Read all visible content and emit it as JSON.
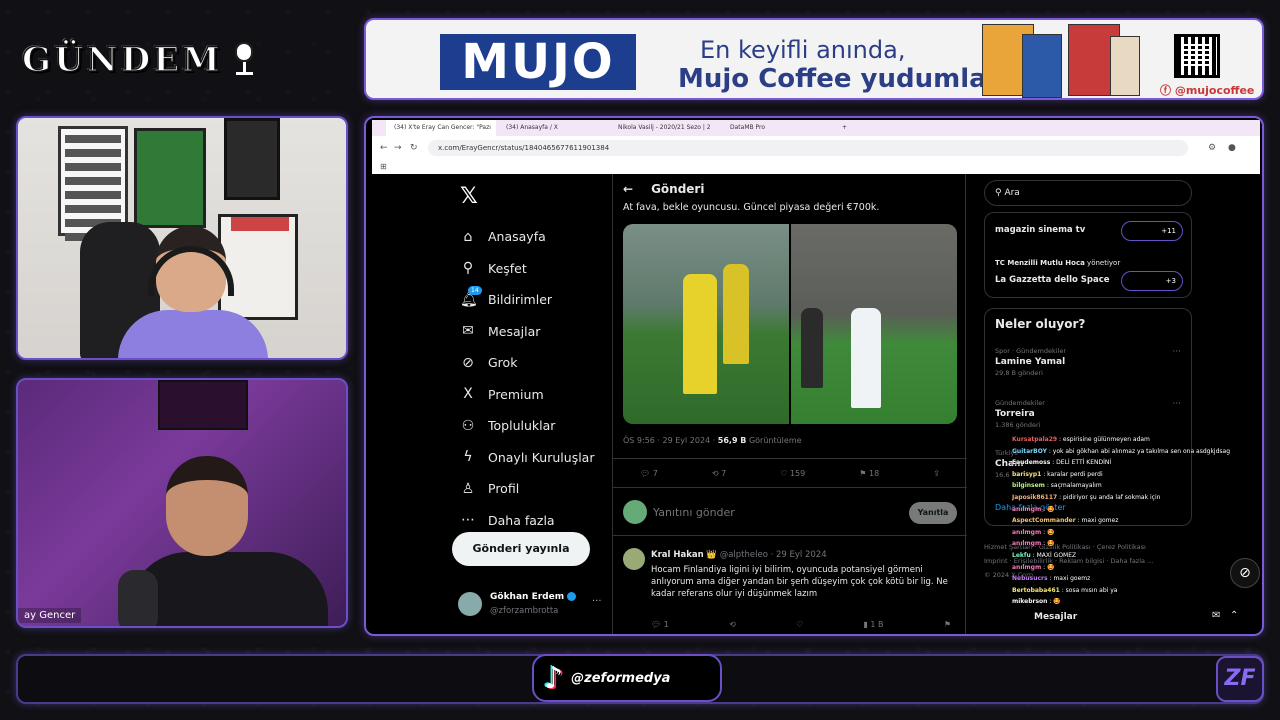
{
  "overlay": {
    "logo_text": "GÜNDEM",
    "camera_name": "ay Gencer",
    "tiktok_handle": "@zeformedya",
    "brand_mark": "ZF"
  },
  "ad": {
    "brand": "MUJO",
    "line1": "En keyifli anında,",
    "line2": "Mujo Coffee yudumla!",
    "handle": "@mujocoffee",
    "accent": "#2b3e86"
  },
  "browser": {
    "tabs": [
      {
        "label": "(34) X'te Eray Can Gencer: \"Pazı",
        "active": true
      },
      {
        "label": "(34) Anasayfa / X",
        "active": false
      },
      {
        "label": "Nikola Vasilj - 2020/21 Sezo | 2",
        "active": false
      },
      {
        "label": "DataMB Pro",
        "active": false
      }
    ],
    "url": "x.com/ErayGencr/status/1840465677611901384"
  },
  "x": {
    "nav": [
      {
        "icon": "home-icon",
        "glyph": "⌂",
        "label": "Anasayfa"
      },
      {
        "icon": "search-icon",
        "glyph": "⚲",
        "label": "Keşfet"
      },
      {
        "icon": "bell-icon",
        "glyph": "♫",
        "label": "Bildirimler",
        "badge": "14"
      },
      {
        "icon": "mail-icon",
        "glyph": "✉",
        "label": "Mesajlar"
      },
      {
        "icon": "grok-icon",
        "glyph": "⊘",
        "label": "Grok"
      },
      {
        "icon": "x-premium-icon",
        "glyph": "X",
        "label": "Premium"
      },
      {
        "icon": "communities-icon",
        "glyph": "⚇",
        "label": "Topluluklar"
      },
      {
        "icon": "bolt-icon",
        "glyph": "ϟ",
        "label": "Onaylı Kuruluşlar"
      },
      {
        "icon": "profile-icon",
        "glyph": "♙",
        "label": "Profil"
      },
      {
        "icon": "more-icon",
        "glyph": "⋯",
        "label": "Daha fazla"
      }
    ],
    "post_button": "Gönderi yayınla",
    "account": {
      "name": "Gökhan Erdem",
      "handle": "@zforzambrotta"
    },
    "header_title": "Gönderi",
    "post_text": "At fava, bekle oyuncusu. Güncel piyasa değeri €700k.",
    "post_meta_time": "ÖS 9:56 · 29 Eyl 2024 · ",
    "post_meta_views": "56,9 B",
    "post_meta_views_label": " Görüntüleme",
    "actions": {
      "replies": "7",
      "reposts": "7",
      "likes": "159",
      "bookmarks": "18"
    },
    "reply_placeholder": "Yanıtını gönder",
    "reply_button": "Yanıtla",
    "comment": {
      "name": "Kral Hakan",
      "handle": "@alptheleo · 29 Eyl 2024",
      "text": "Hocam Finlandiya ligini iyi bilirim, oyuncuda potansiyel görmeni anlıyorum ama diğer yandan bir şerh düşeyim çok çok kötü bir lig. Ne kadar referans olur iyi düşünmek lazım",
      "replies": "1",
      "views": "1 B"
    },
    "search_placeholder": "Ara",
    "communities": [
      {
        "name": "magazin sinema tv",
        "count": "+11"
      },
      {
        "owner": "TC Menzilli Mutlu Hoca",
        "owner_suffix": "yönetiyor",
        "name": "La Gazzetta dello Space",
        "count": "+3"
      }
    ],
    "trends_title": "Neler oluyor?",
    "trends": [
      {
        "context": "Spor · Gündemdekiler",
        "name": "Lamine Yamal",
        "count": "29,8 B gönderi"
      },
      {
        "context": "Gündemdekiler",
        "name": "Torreira",
        "count": "1.386 gönderi"
      },
      {
        "context": "Türkiye",
        "name": "Cham",
        "count": "16,6"
      }
    ],
    "show_more": "Daha fazla göster",
    "footer": [
      "Hizmet Şartları",
      "Gizlilik Politikası",
      "Çerez Politikası",
      "Imprint",
      "Erişilebilirlik",
      "Reklam bilgisi",
      "Daha fazla ...",
      "© 2024 X Corp."
    ],
    "messages_label": "Mesajlar"
  },
  "chat": [
    {
      "user": "Kursatpala29",
      "color": "#e85d5d",
      "text": "espirisine gülünmeyen adam"
    },
    {
      "user": "GuitarBOY",
      "color": "#7ad6f5",
      "text": "yok abi gökhan abi alınmaz ya takılma sen ona asdgkjdsag"
    },
    {
      "user": "Eaudemoss",
      "color": "#f5f5f5",
      "text": "DELİ ETTİ KENDİNİ"
    },
    {
      "user": "barisyp1",
      "color": "#f5e67a",
      "text": "karalar perdi perdi"
    },
    {
      "user": "bilginsem",
      "color": "#b9f57a",
      "text": "saçmalamayalım"
    },
    {
      "user": "Japosik86117",
      "color": "#f5b27a",
      "text": "pidiriyor şu anda laf sokmak için"
    },
    {
      "user": "anılmgm",
      "color": "#f57ab9",
      "text": "🤩"
    },
    {
      "user": "AspectCommander",
      "color": "#f5c27a",
      "text": "maxi gomez"
    },
    {
      "user": "anılmgm",
      "color": "#f57ab9",
      "text": "🤩"
    },
    {
      "user": "anılmgm",
      "color": "#f57ab9",
      "text": "🤩"
    },
    {
      "user": "Lekfu",
      "color": "#7af5c2",
      "text": "MAXİ GOMEZ"
    },
    {
      "user": "anılmgm",
      "color": "#f57ab9",
      "text": "🤩"
    },
    {
      "user": "Nebusucrs",
      "color": "#c27af5",
      "text": "maxi goemz"
    },
    {
      "user": "Bertobaba461",
      "color": "#f5e67a",
      "text": "sosa mısın abi ya"
    },
    {
      "user": "mikebrson",
      "color": "#f5f5f5",
      "text": "🤩"
    }
  ]
}
